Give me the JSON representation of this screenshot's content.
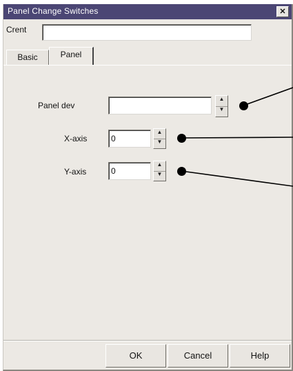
{
  "window": {
    "title": "Panel Change Switches",
    "close_glyph": "✕",
    "close_icon": "close-icon"
  },
  "crnt": {
    "label": "Crent",
    "value": ""
  },
  "tabs": [
    {
      "label": "Basic",
      "active": false
    },
    {
      "label": "Panel",
      "active": true
    }
  ],
  "panel": {
    "panel_dev": {
      "label": "Panel dev",
      "value": ""
    },
    "x_axis": {
      "label": "X-axis",
      "value": "0"
    },
    "y_axis": {
      "label": "Y-axis",
      "value": "0"
    },
    "spin_up_glyph": "▲",
    "spin_down_glyph": "▼"
  },
  "buttons": {
    "ok": "OK",
    "cancel": "Cancel",
    "help": "Help"
  },
  "colors": {
    "titlebar": "#4b4674",
    "dialog_bg": "#ece9e4",
    "callout": "#000000"
  }
}
